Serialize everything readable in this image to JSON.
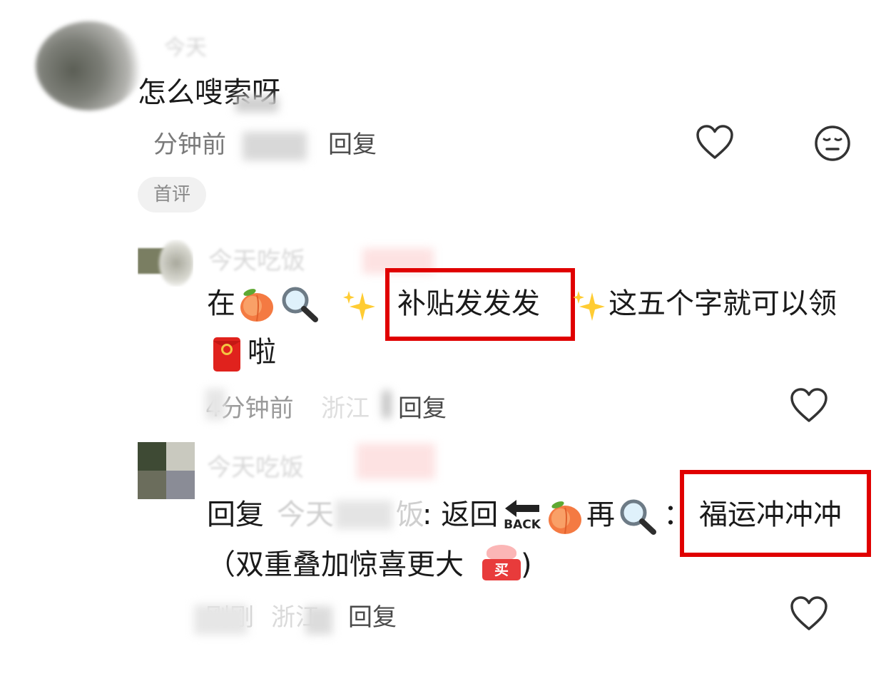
{
  "comments": [
    {
      "author": "今天",
      "text": "怎么嗖索呀",
      "time": "分钟前",
      "reply_label": "回复",
      "badge": "首评"
    },
    {
      "author": "今天吃饭",
      "text_line1_prefix": "在",
      "highlight": "补贴发发发",
      "text_line1_suffix": "这五个字就可以领",
      "text_line2": "啦",
      "time": "4分钟前",
      "location": "浙江",
      "reply_label": "回复"
    },
    {
      "author": "今天吃饭",
      "reply_prefix": "回复",
      "reply_to": "今天",
      "reply_to_end": "饭",
      "text_a": ": 返回",
      "back_label": "BACK",
      "text_b": "再",
      "text_c": "：",
      "highlight": "福运冲冲冲",
      "text_line2": "（双重叠加惊喜更大",
      "text_line2_end": ")",
      "buy_label": "买",
      "time": "刚刚",
      "location": "浙江",
      "reply_label": "回复"
    }
  ],
  "icons": [
    "heart-icon",
    "dislike-face-icon",
    "peach-emoji",
    "magnifier-emoji",
    "sparkles-emoji",
    "red-envelope-emoji",
    "back-arrow-emoji",
    "buy-sticker-emoji"
  ],
  "colors": {
    "highlight_box": "#e00000",
    "meta": "#8a8a8a"
  }
}
